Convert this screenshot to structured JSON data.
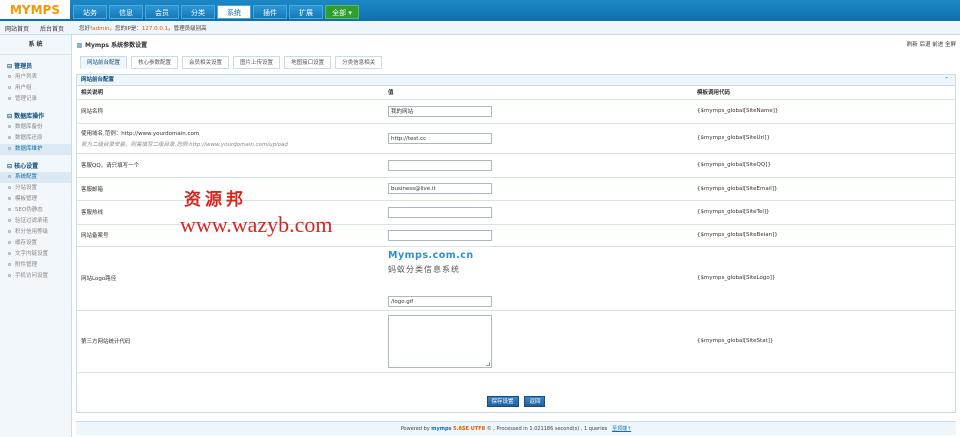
{
  "app": {
    "logo": "MYMPS"
  },
  "nav": {
    "tabs": [
      "站务",
      "信息",
      "会员",
      "分类",
      "系统",
      "插件",
      "扩展",
      "全部 ▾"
    ],
    "active_index": 4
  },
  "subbar": {
    "site_home": "网站首页",
    "admin_home": "后台首页",
    "welcome_prefix": "您好!",
    "user": "admin",
    "welcome_mid": "。您的IP是：",
    "ip": "127.0.0.1",
    "welcome_suffix": "。管理员级别高"
  },
  "sidebar": {
    "title": "系 统",
    "groups": [
      {
        "head": "管理员",
        "items": [
          "用户列表",
          "用户组",
          "管理记录"
        ]
      },
      {
        "head": "数据库操作",
        "items": [
          "数据库备份",
          "数据库还原",
          "数据库维护"
        ]
      },
      {
        "head": "核心设置",
        "items": [
          "系统配置",
          "分站设置",
          "模板管理",
          "SEO伪静态",
          "验证过滤承诺",
          "积分信用等级",
          "缓存设置",
          "文字内链设置",
          "附件管理",
          "手机访问设置"
        ]
      }
    ]
  },
  "page": {
    "title": "Mymps 系统参数设置",
    "tools": [
      "刷新",
      "后退",
      "前进",
      "全屏"
    ]
  },
  "tabs": [
    "网站前台配置",
    "核心参数配置",
    "会员相关设置",
    "图片上传设置",
    "地图接口设置",
    "分类信息相关"
  ],
  "panel": {
    "head": "网站前台配置",
    "collapse": "⌃",
    "col_desc": "相关说明",
    "col_value": "值",
    "col_code": "模板调用代码"
  },
  "rows": [
    {
      "label": "网站名称",
      "value": "我的网站",
      "code": "{$mymps_global[SiteName]}"
    },
    {
      "label": "使用域名,范例：http://www.yourdomain.com",
      "hint": "若为二级目录安装，则需填写二级目录,范例:http://www.yourdomain.com/upload",
      "value": "http://test.cc",
      "code": "{$mymps_global[SiteUrl]}"
    },
    {
      "label": "客服QQ，请只填写一个",
      "value": "",
      "code": "{$mymps_global[SiteQQ]}"
    },
    {
      "label": "客服邮箱",
      "value": "business@live.it",
      "code": "{$mymps_global[SiteEmail]}"
    },
    {
      "label": "客服热线",
      "value": "",
      "code": "{$mymps_global[SiteTel]}"
    },
    {
      "label": "网站备案号",
      "value": "",
      "code": "{$mymps_global[SiteBeian]}"
    },
    {
      "label": "网站Logo路径",
      "logo_line1": "Mymps.com.cn",
      "logo_line2": "蚂蚁分类信息系统",
      "value": "/logo.gif",
      "code": "{$mymps_global[SiteLogo]}"
    },
    {
      "label": "第三方网站统计代码",
      "value": "",
      "code": "{$mymps_global[SiteStat]}"
    }
  ],
  "buttons": {
    "save": "保存设置",
    "back": "返回"
  },
  "footer": {
    "prefix": "Powered by ",
    "brand": "mymps",
    "version": "5.8SE UTF8",
    "rest": " © , Processed in 1.021186 second(s) , 1 queries",
    "link": "至顶端↑"
  },
  "watermark": {
    "line1": "资源邦",
    "line2": "www.wazyb.com"
  },
  "colors": {
    "nav_blue": "#1678b8",
    "logo_orange": "#f39800",
    "accent_orange": "#e05b00",
    "watermark_red": "#d8261f"
  }
}
